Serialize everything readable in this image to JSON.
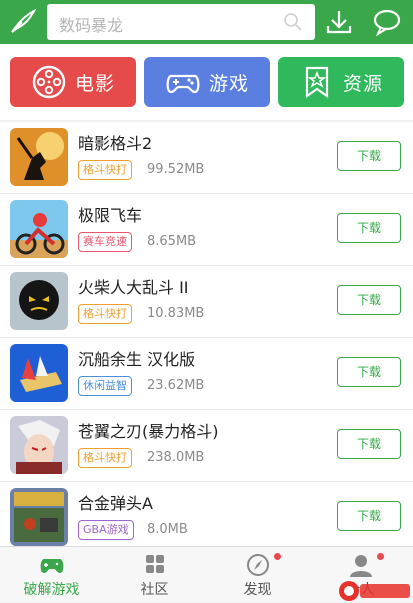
{
  "search": {
    "placeholder": "数码暴龙"
  },
  "categories": [
    {
      "label": "电影",
      "icon": "film-reel-icon",
      "color": "#e64b4b"
    },
    {
      "label": "游戏",
      "icon": "gamepad-icon",
      "color": "#5b7fe0"
    },
    {
      "label": "资源",
      "icon": "bookmark-star-icon",
      "color": "#2fb85c"
    }
  ],
  "games": [
    {
      "name": "暗影格斗2",
      "tag": "格斗快打",
      "tag_color": "#f0a030",
      "size": "99.52MB",
      "button": "下载"
    },
    {
      "name": "极限飞车",
      "tag": "赛车竞速",
      "tag_color": "#e8566e",
      "size": "8.65MB",
      "button": "下载"
    },
    {
      "name": "火柴人大乱斗 II",
      "tag": "格斗快打",
      "tag_color": "#f0a030",
      "size": "10.83MB",
      "button": "下载"
    },
    {
      "name": "沉船余生  汉化版",
      "tag": "休闲益智",
      "tag_color": "#4a90d9",
      "size": "23.62MB",
      "button": "下载"
    },
    {
      "name": "苍翼之刃(暴力格斗)",
      "tag": "格斗快打",
      "tag_color": "#f0a030",
      "size": "238.0MB",
      "button": "下载"
    },
    {
      "name": "合金弹头A",
      "tag": "GBA游戏",
      "tag_color": "#a066d0",
      "size": "8.0MB",
      "button": "下载"
    }
  ],
  "bottom_nav": [
    {
      "label": "破解游戏",
      "icon": "gamepad-icon",
      "active": true
    },
    {
      "label": "社区",
      "icon": "grid-icon",
      "active": false
    },
    {
      "label": "发现",
      "icon": "compass-icon",
      "active": false,
      "badge": true
    },
    {
      "label": "个人",
      "icon": "user-icon",
      "active": false,
      "badge": true
    }
  ],
  "colors": {
    "brand": "#3aa84a",
    "badge": "#e64b4b"
  }
}
